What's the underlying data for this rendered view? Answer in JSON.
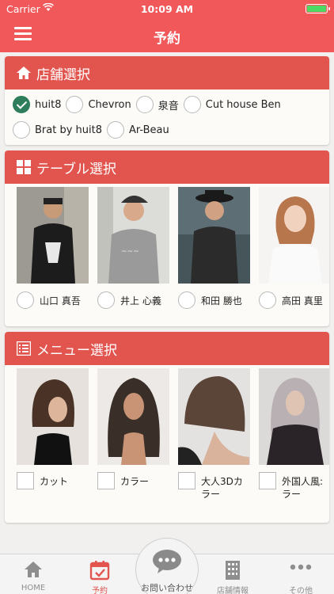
{
  "status": {
    "carrier": "Carrier",
    "time": "10:09 AM"
  },
  "nav": {
    "title": "予約"
  },
  "store_section": {
    "title": "店舗選択",
    "options": [
      {
        "label": "huit8",
        "checked": true
      },
      {
        "label": "Chevron",
        "checked": false
      },
      {
        "label": "泉音",
        "checked": false
      },
      {
        "label": "Cut house Ben",
        "checked": false
      },
      {
        "label": "Brat by huit8",
        "checked": false
      },
      {
        "label": "Ar-Beau",
        "checked": false
      }
    ]
  },
  "table_section": {
    "title": "テーブル選択",
    "stylists": [
      {
        "name": "山口 真吾"
      },
      {
        "name": "井上 心義"
      },
      {
        "name": "和田 勝也"
      },
      {
        "name": "高田 真里"
      }
    ]
  },
  "menu_section": {
    "title": "メニュー選択",
    "items": [
      {
        "label": "カット"
      },
      {
        "label": "カラー"
      },
      {
        "label": "大人3Dカラー"
      },
      {
        "label": "外国人風:ラー"
      }
    ]
  },
  "tabbar": {
    "home": "HOME",
    "reserve": "予約",
    "contact": "お問い合わせ",
    "store_info": "店舗情報",
    "other": "その他"
  },
  "colors": {
    "accent": "#f0585a",
    "header": "#e2554f",
    "checked": "#2e7d5b"
  }
}
